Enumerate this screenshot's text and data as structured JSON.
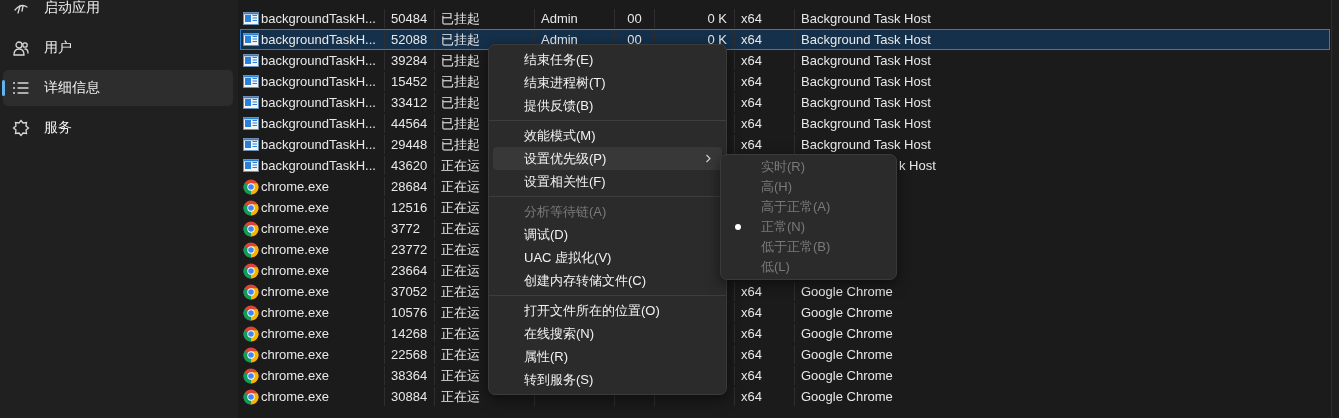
{
  "sidebar": {
    "items": [
      {
        "label": "启动应用",
        "selected": false
      },
      {
        "label": "用户",
        "selected": false
      },
      {
        "label": "详细信息",
        "selected": true
      },
      {
        "label": "服务",
        "selected": false
      }
    ]
  },
  "table": {
    "rows": [
      {
        "kind": "task-host",
        "name": "backgroundTaskH...",
        "pid": "50484",
        "status": "已挂起",
        "user": "Admin",
        "cpu": "00",
        "memory": "0 K",
        "arch": "x64",
        "description": "Background Task Host",
        "selected": false
      },
      {
        "kind": "task-host",
        "name": "backgroundTaskH...",
        "pid": "52088",
        "status": "已挂起",
        "user": "Admin",
        "cpu": "00",
        "memory": "0 K",
        "arch": "x64",
        "description": "Background Task Host",
        "selected": true
      },
      {
        "kind": "task-host",
        "name": "backgroundTaskH...",
        "pid": "39284",
        "status": "已挂起",
        "arch": "x64",
        "description": "Background Task Host",
        "selected": false
      },
      {
        "kind": "task-host",
        "name": "backgroundTaskH...",
        "pid": "15452",
        "status": "已挂起",
        "arch": "x64",
        "description": "Background Task Host",
        "selected": false
      },
      {
        "kind": "task-host",
        "name": "backgroundTaskH...",
        "pid": "33412",
        "status": "已挂起",
        "arch": "x64",
        "description": "Background Task Host",
        "selected": false
      },
      {
        "kind": "task-host",
        "name": "backgroundTaskH...",
        "pid": "44564",
        "status": "已挂起",
        "arch": "x64",
        "description": "Background Task Host",
        "selected": false
      },
      {
        "kind": "task-host",
        "name": "backgroundTaskH...",
        "pid": "29448",
        "status": "已挂起",
        "arch": "x64",
        "description": "Background Task Host",
        "selected": false
      },
      {
        "kind": "task-host",
        "name": "backgroundTaskH...",
        "pid": "43620",
        "status": "正在运",
        "description": "k Host",
        "selected": false
      },
      {
        "kind": "chrome",
        "name": "chrome.exe",
        "pid": "28684",
        "status": "正在运",
        "selected": false
      },
      {
        "kind": "chrome",
        "name": "chrome.exe",
        "pid": "12516",
        "status": "正在运",
        "selected": false
      },
      {
        "kind": "chrome",
        "name": "chrome.exe",
        "pid": "3772",
        "status": "正在运",
        "selected": false
      },
      {
        "kind": "chrome",
        "name": "chrome.exe",
        "pid": "23772",
        "status": "正在运",
        "selected": false
      },
      {
        "kind": "chrome",
        "name": "chrome.exe",
        "pid": "23664",
        "status": "正在运",
        "selected": false
      },
      {
        "kind": "chrome",
        "name": "chrome.exe",
        "pid": "37052",
        "status": "正在运",
        "arch": "x64",
        "description": "Google Chrome",
        "selected": false
      },
      {
        "kind": "chrome",
        "name": "chrome.exe",
        "pid": "10576",
        "status": "正在运",
        "arch": "x64",
        "description": "Google Chrome",
        "selected": false
      },
      {
        "kind": "chrome",
        "name": "chrome.exe",
        "pid": "14268",
        "status": "正在运",
        "arch": "x64",
        "description": "Google Chrome",
        "selected": false
      },
      {
        "kind": "chrome",
        "name": "chrome.exe",
        "pid": "22568",
        "status": "正在运",
        "arch": "x64",
        "description": "Google Chrome",
        "selected": false
      },
      {
        "kind": "chrome",
        "name": "chrome.exe",
        "pid": "38364",
        "status": "正在运",
        "arch": "x64",
        "description": "Google Chrome",
        "selected": false
      },
      {
        "kind": "chrome",
        "name": "chrome.exe",
        "pid": "30884",
        "status": "正在运",
        "arch": "x64",
        "description": "Google Chrome",
        "selected": false
      }
    ]
  },
  "context_menu": {
    "items": [
      {
        "kind": "item",
        "label": "结束任务(E)",
        "disabled": false,
        "highlighted": false,
        "submenu": false
      },
      {
        "kind": "item",
        "label": "结束进程树(T)",
        "disabled": false,
        "highlighted": false,
        "submenu": false
      },
      {
        "kind": "item",
        "label": "提供反馈(B)",
        "disabled": false,
        "highlighted": false,
        "submenu": false
      },
      {
        "kind": "separator"
      },
      {
        "kind": "item",
        "label": "效能模式(M)",
        "disabled": false,
        "highlighted": false,
        "submenu": false
      },
      {
        "kind": "item",
        "label": "设置优先级(P)",
        "disabled": false,
        "highlighted": true,
        "submenu": true
      },
      {
        "kind": "item",
        "label": "设置相关性(F)",
        "disabled": false,
        "highlighted": false,
        "submenu": false
      },
      {
        "kind": "separator"
      },
      {
        "kind": "item",
        "label": "分析等待链(A)",
        "disabled": true,
        "highlighted": false,
        "submenu": false
      },
      {
        "kind": "item",
        "label": "调试(D)",
        "disabled": false,
        "highlighted": false,
        "submenu": false
      },
      {
        "kind": "item",
        "label": "UAC 虚拟化(V)",
        "disabled": false,
        "highlighted": false,
        "submenu": false
      },
      {
        "kind": "item",
        "label": "创建内存转储文件(C)",
        "disabled": false,
        "highlighted": false,
        "submenu": false
      },
      {
        "kind": "separator"
      },
      {
        "kind": "item",
        "label": "打开文件所在的位置(O)",
        "disabled": false,
        "highlighted": false,
        "submenu": false
      },
      {
        "kind": "item",
        "label": "在线搜索(N)",
        "disabled": false,
        "highlighted": false,
        "submenu": false
      },
      {
        "kind": "item",
        "label": "属性(R)",
        "disabled": false,
        "highlighted": false,
        "submenu": false
      },
      {
        "kind": "item",
        "label": "转到服务(S)",
        "disabled": false,
        "highlighted": false,
        "submenu": false
      }
    ]
  },
  "submenu": {
    "items": [
      {
        "label": "实时(R)",
        "disabled": true,
        "selected": false
      },
      {
        "label": "高(H)",
        "disabled": true,
        "selected": false
      },
      {
        "label": "高于正常(A)",
        "disabled": true,
        "selected": false
      },
      {
        "label": "正常(N)",
        "disabled": true,
        "selected": true
      },
      {
        "label": "低于正常(B)",
        "disabled": true,
        "selected": false
      },
      {
        "label": "低(L)",
        "disabled": true,
        "selected": false
      }
    ]
  }
}
